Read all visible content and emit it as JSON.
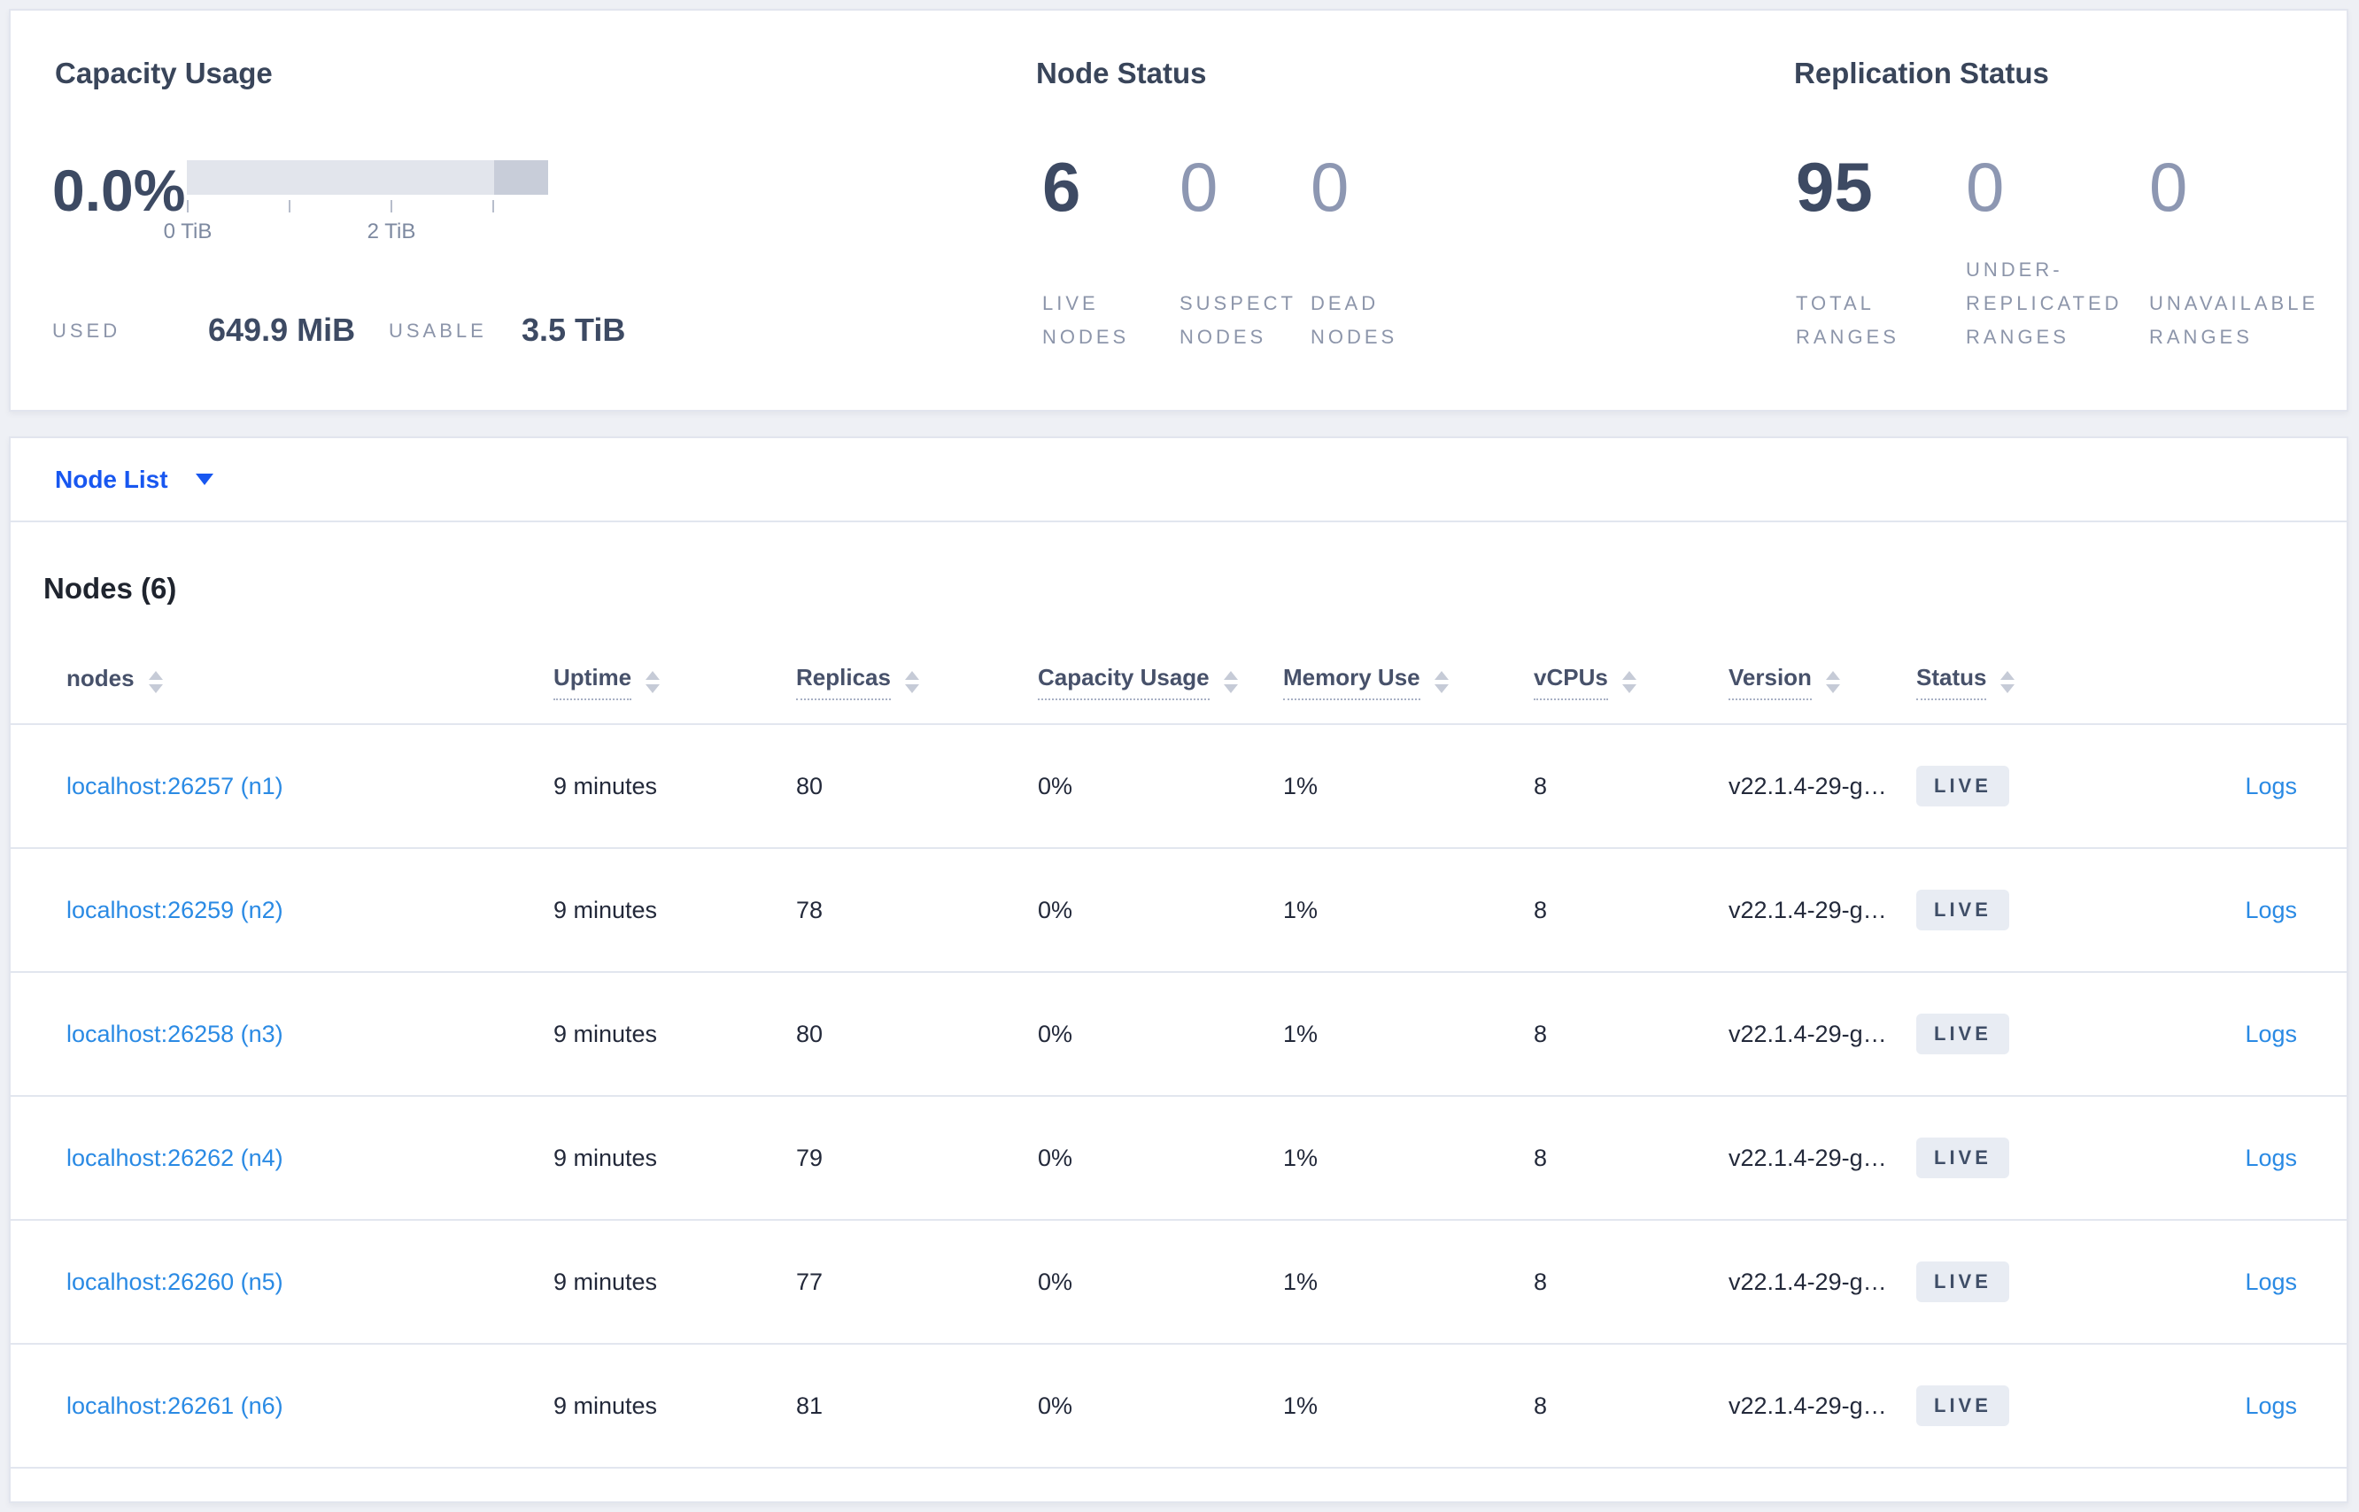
{
  "colors": {
    "accent_blue": "#1857f0",
    "link_blue": "#2a8ae4",
    "number_dark": "#3d4a63",
    "number_muted": "#8d97b2",
    "badge_bg": "#e8ecf3",
    "badge_text": "#3f4e67",
    "bar_light": "#e2e5ec",
    "bar_dark": "#c8cdd9"
  },
  "capacity": {
    "title": "Capacity Usage",
    "percent": "0.0%",
    "axis": {
      "tick_labels": [
        "0 TiB",
        "2 TiB"
      ]
    },
    "used_label": "USED",
    "used_value": "649.9 MiB",
    "usable_label": "USABLE",
    "usable_value": "3.5 TiB"
  },
  "node_status": {
    "title": "Node Status",
    "stats": [
      {
        "value": "6",
        "primary": true,
        "label_lines": [
          "LIVE",
          "NODES"
        ]
      },
      {
        "value": "0",
        "primary": false,
        "label_lines": [
          "SUSPECT",
          "NODES"
        ]
      },
      {
        "value": "0",
        "primary": false,
        "label_lines": [
          "DEAD",
          "NODES"
        ]
      }
    ]
  },
  "replication_status": {
    "title": "Replication Status",
    "stats": [
      {
        "value": "95",
        "primary": true,
        "label_lines": [
          "TOTAL",
          "RANGES"
        ]
      },
      {
        "value": "0",
        "primary": false,
        "label_lines": [
          "UNDER-",
          "REPLICATED",
          "RANGES"
        ]
      },
      {
        "value": "0",
        "primary": false,
        "label_lines": [
          "UNAVAILABLE",
          "RANGES"
        ]
      }
    ]
  },
  "node_list_bar": {
    "label": "Node List"
  },
  "nodes_section": {
    "title": "Nodes (6)",
    "columns": [
      {
        "label": "nodes",
        "underline": false
      },
      {
        "label": "Uptime",
        "underline": true
      },
      {
        "label": "Replicas",
        "underline": true
      },
      {
        "label": "Capacity Usage",
        "underline": true
      },
      {
        "label": "Memory Use",
        "underline": true
      },
      {
        "label": "vCPUs",
        "underline": true
      },
      {
        "label": "Version",
        "underline": true
      },
      {
        "label": "Status",
        "underline": true
      }
    ],
    "rows": [
      {
        "node": "localhost:26257 (n1)",
        "uptime": "9 minutes",
        "replicas": "80",
        "capacity": "0%",
        "memory": "1%",
        "vcpus": "8",
        "version": "v22.1.4-29-g…",
        "status": "LIVE",
        "logs": "Logs"
      },
      {
        "node": "localhost:26259 (n2)",
        "uptime": "9 minutes",
        "replicas": "78",
        "capacity": "0%",
        "memory": "1%",
        "vcpus": "8",
        "version": "v22.1.4-29-g…",
        "status": "LIVE",
        "logs": "Logs"
      },
      {
        "node": "localhost:26258 (n3)",
        "uptime": "9 minutes",
        "replicas": "80",
        "capacity": "0%",
        "memory": "1%",
        "vcpus": "8",
        "version": "v22.1.4-29-g…",
        "status": "LIVE",
        "logs": "Logs"
      },
      {
        "node": "localhost:26262 (n4)",
        "uptime": "9 minutes",
        "replicas": "79",
        "capacity": "0%",
        "memory": "1%",
        "vcpus": "8",
        "version": "v22.1.4-29-g…",
        "status": "LIVE",
        "logs": "Logs"
      },
      {
        "node": "localhost:26260 (n5)",
        "uptime": "9 minutes",
        "replicas": "77",
        "capacity": "0%",
        "memory": "1%",
        "vcpus": "8",
        "version": "v22.1.4-29-g…",
        "status": "LIVE",
        "logs": "Logs"
      },
      {
        "node": "localhost:26261 (n6)",
        "uptime": "9 minutes",
        "replicas": "81",
        "capacity": "0%",
        "memory": "1%",
        "vcpus": "8",
        "version": "v22.1.4-29-g…",
        "status": "LIVE",
        "logs": "Logs"
      }
    ]
  }
}
